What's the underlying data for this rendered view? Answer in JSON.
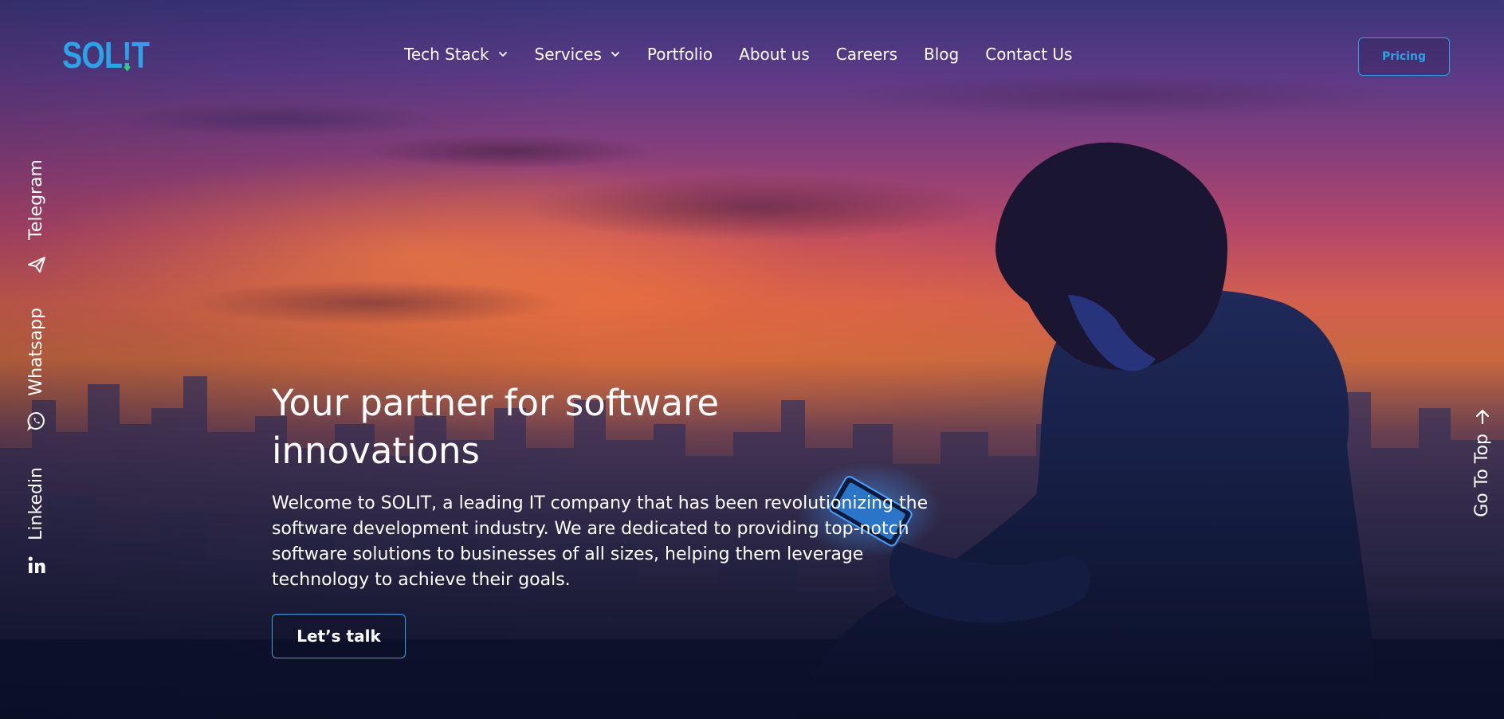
{
  "brand": {
    "logo_text_a": "SOL",
    "logo_text_b": "!",
    "logo_text_c": "T",
    "accent_color": "#2aa4e6",
    "green_accent": "#27d17a"
  },
  "nav": {
    "items": [
      {
        "label": "Tech Stack",
        "has_dropdown": true,
        "icon": "chevron-down-icon"
      },
      {
        "label": "Services",
        "has_dropdown": true,
        "icon": "chevron-down-icon"
      },
      {
        "label": "Portfolio",
        "has_dropdown": false
      },
      {
        "label": "About us",
        "has_dropdown": false
      },
      {
        "label": "Careers",
        "has_dropdown": false
      },
      {
        "label": "Blog",
        "has_dropdown": false
      },
      {
        "label": "Contact Us",
        "has_dropdown": false
      }
    ],
    "pricing_label": "Pricing"
  },
  "social": {
    "items": [
      {
        "label": "Telegram",
        "icon": "telegram-icon"
      },
      {
        "label": "Whatsapp",
        "icon": "whatsapp-icon"
      },
      {
        "label": "Linkedin",
        "icon": "linkedin-icon"
      }
    ]
  },
  "go_to_top": {
    "label": "Go To Top",
    "icon": "arrow-up-icon"
  },
  "hero": {
    "title": "Your partner for software innovations",
    "description": "Welcome to SOLIT, a leading IT company that has been revolutionizing the software development industry. We are dedicated to providing top-notch software solutions to businesses of all sizes, helping them leverage technology to achieve their goals.",
    "cta_label": "Let’s talk"
  }
}
